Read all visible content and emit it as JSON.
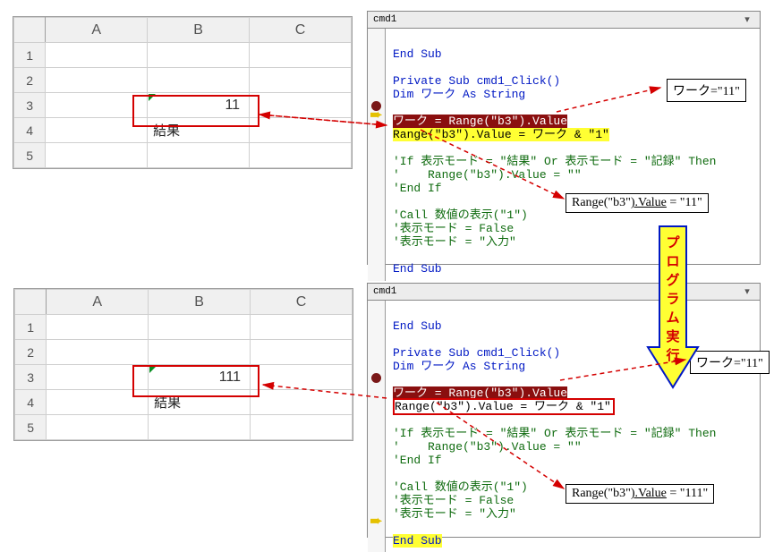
{
  "excel_top": {
    "cols": [
      "A",
      "B",
      "C"
    ],
    "rows": [
      "1",
      "2",
      "3",
      "4",
      "5"
    ],
    "b3_value": "11",
    "b4_label": "結果"
  },
  "excel_bottom": {
    "cols": [
      "A",
      "B",
      "C"
    ],
    "rows": [
      "1",
      "2",
      "3",
      "4",
      "5"
    ],
    "b3_value": "111",
    "b4_label": "結果"
  },
  "code_top": {
    "title": "cmd1",
    "end_sub_prev": "End Sub",
    "l1": "Private Sub cmd1_Click()",
    "l2": "Dim ワーク As String",
    "l3_highlight": "ワーク = Range(\"b3\").Value",
    "l4_step": "Range(\"b3\").Value = ワーク & \"1\"",
    "l5": "'If 表示モード = \"結果\" Or 表示モード = \"記録\" Then",
    "l6": "'    Range(\"b3\").Value = \"\"",
    "l7": "'End If",
    "l8": "'Call 数値の表示(\"1\")",
    "l9": "'表示モード = False",
    "l10": "'表示モード = \"入力\"",
    "l11": "End Sub"
  },
  "code_bottom": {
    "title": "cmd1",
    "end_sub_prev": "End Sub",
    "l1": "Private Sub cmd1_Click()",
    "l2": "Dim ワーク As String",
    "l3_highlight": "ワーク = Range(\"b3\").Value",
    "l4_boxed": "Range(\"b3\").Value = ワーク & \"1\"",
    "l5": "'If 表示モード = \"結果\" Or 表示モード = \"記録\" Then",
    "l6": "'    Range(\"b3\").Value = \"\"",
    "l7": "'End If",
    "l8": "'Call 数値の表示(\"1\")",
    "l9": "'表示モード = False",
    "l10": "'表示モード = \"入力\"",
    "l11_step": "End Sub"
  },
  "labels": {
    "work_top": "ワーク=\"11\"",
    "range_top_a": "Range(\"b3\"",
    "range_top_b": ").Value",
    "range_top_c": " = \"11\"",
    "work_bottom": "ワーク=\"11\"",
    "range_bottom_a": "Range(\"b3\"",
    "range_bottom_b": ").Value",
    "range_bottom_c": " = \"111\"",
    "bigarrow_text": "プログラム実行"
  }
}
